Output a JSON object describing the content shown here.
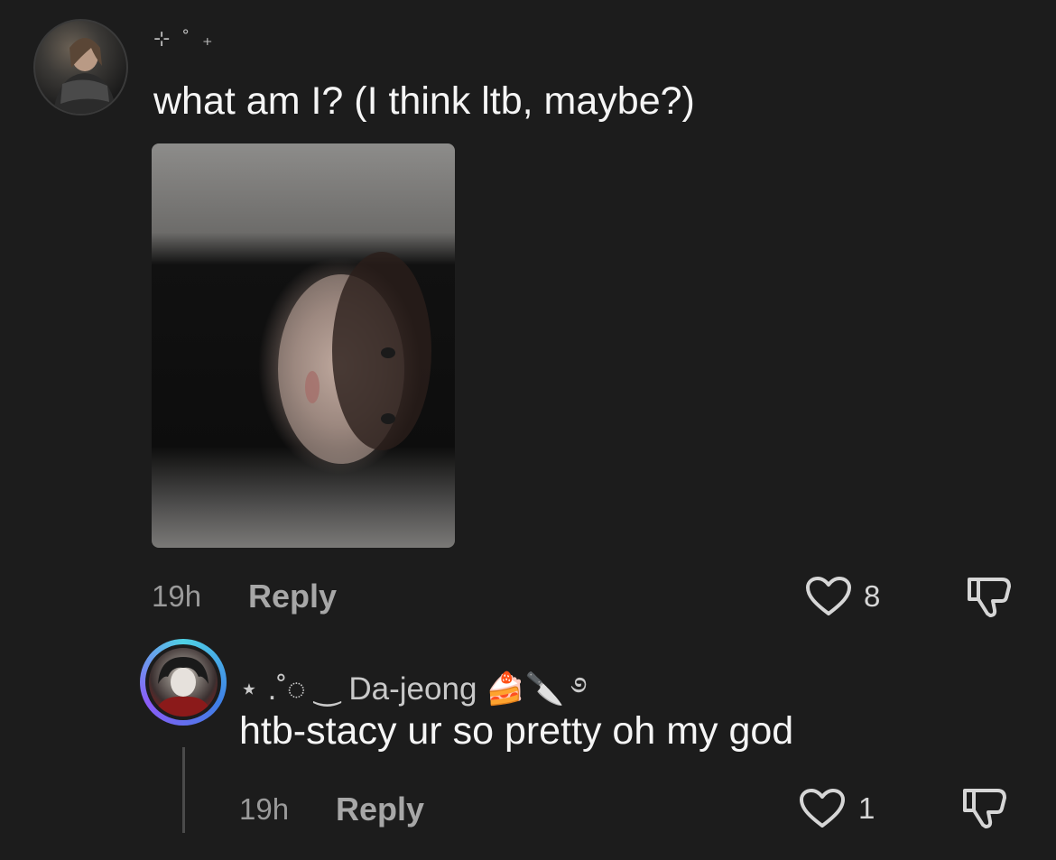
{
  "comment1": {
    "username": "⊹ ˚ ₊",
    "text": "what am I? (I think ltb, maybe?)",
    "timestamp": "19h",
    "reply_label": "Reply",
    "like_count": "8",
    "avatar_icon": "profile-photo",
    "image_icon": "selfie-photo"
  },
  "comment2": {
    "username": "⋆ .˚◌ ‿ Da-jeong 🍰🔪 ࿔",
    "text": "htb-stacy ur so pretty oh my god",
    "timestamp": "19h",
    "reply_label": "Reply",
    "like_count": "1",
    "avatar_icon": "profile-photo",
    "story_ring_colors": [
      "#4fd2e5",
      "#3f7fe6",
      "#8b5cf6"
    ]
  },
  "icons": {
    "like": "heart-icon",
    "dislike": "thumbs-down-icon"
  },
  "colors": {
    "background": "#1c1c1c",
    "primary_text": "#f5f5f5",
    "secondary_text": "#9a9a9a"
  }
}
